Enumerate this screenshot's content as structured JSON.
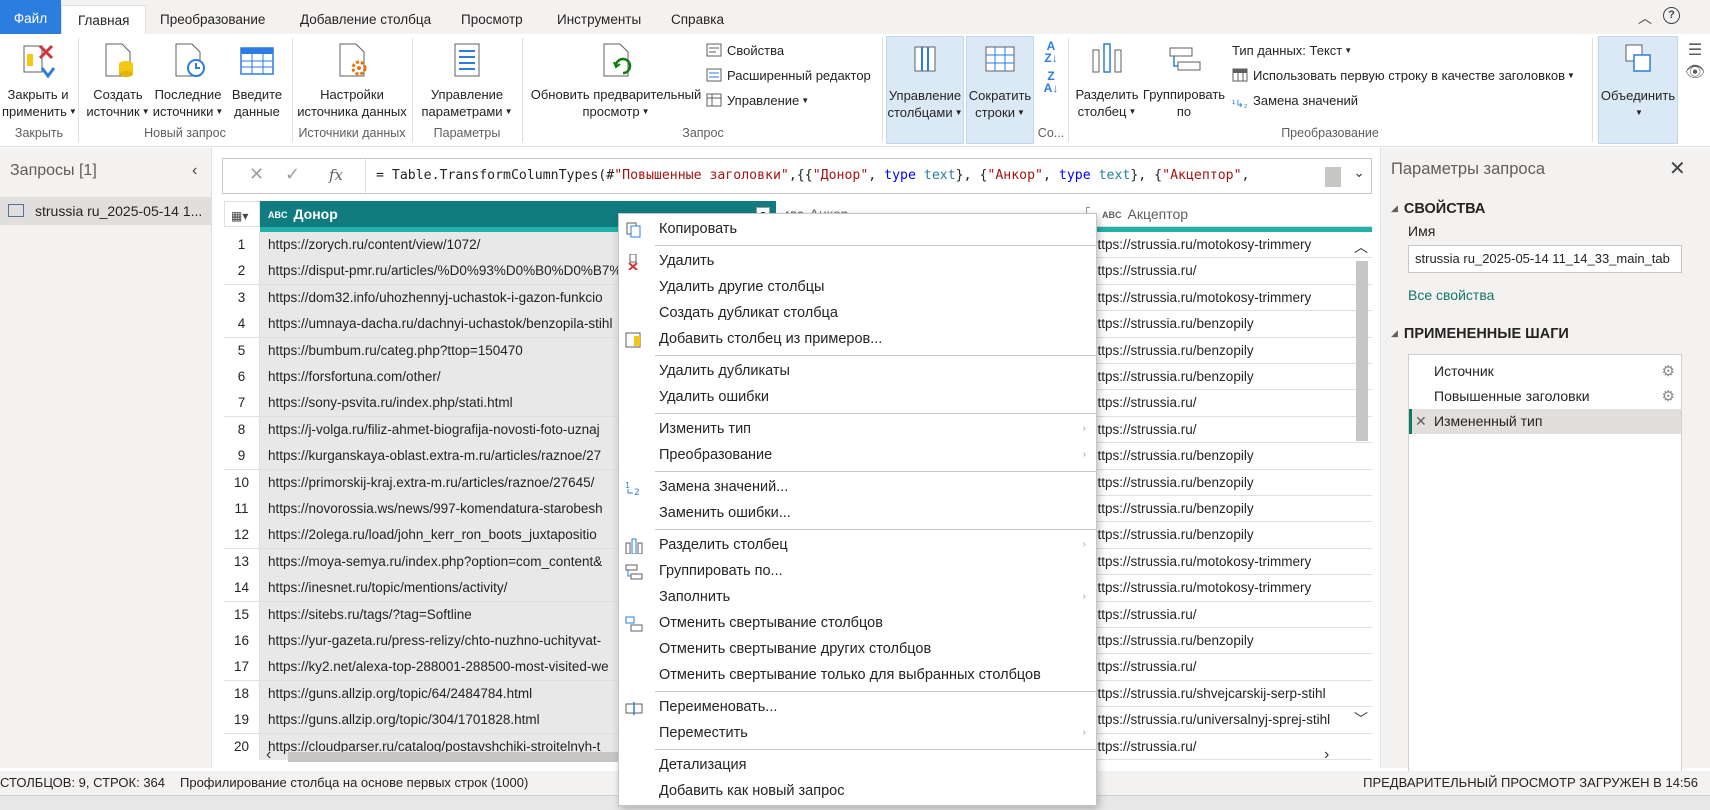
{
  "tabs": [
    "Файл",
    "Главная",
    "Преобразование",
    "Добавление столбца",
    "Просмотр",
    "Инструменты",
    "Справка"
  ],
  "ribbon": {
    "close_apply": [
      "Закрыть и",
      "применить"
    ],
    "new_source": [
      "Создать",
      "источник"
    ],
    "recent_sources": [
      "Последние",
      "источники"
    ],
    "enter_data": [
      "Введите",
      "данные"
    ],
    "ds_settings": [
      "Настройки",
      "источника данных"
    ],
    "manage_params": [
      "Управление",
      "параметрами"
    ],
    "refresh_preview": [
      "Обновить предварительный",
      "просмотр"
    ],
    "properties": "Свойства",
    "advanced_editor": "Расширенный редактор",
    "manage": "Управление",
    "manage_columns": [
      "Управление",
      "столбцами"
    ],
    "reduce_rows": [
      "Сократить",
      "строки"
    ],
    "split_column": [
      "Разделить",
      "столбец"
    ],
    "group_by": [
      "Группировать",
      "по"
    ],
    "data_type": "Тип данных: Текст",
    "first_row_headers": "Использовать первую строку в качестве заголовков",
    "replace_values": "Замена значений",
    "combine": "Объединить",
    "groups": {
      "close": "Закрыть",
      "new_query": "Новый запрос",
      "data_sources": "Источники данных",
      "params": "Параметры",
      "query": "Запрос",
      "sort_short": "Со...",
      "transform": "Преобразование"
    }
  },
  "queries": {
    "title": "Запросы [1]",
    "items": [
      "strussia ru_2025-05-14 1..."
    ]
  },
  "formula": {
    "prefix": "= Table.TransformColumnTypes(#",
    "s1": "\"Повышенные заголовки\"",
    "mid1": ",{{",
    "s2": "\"Донор\"",
    "c1": ", ",
    "kw1": "type",
    "sp": " ",
    "t1": "text",
    "mid2": "}, {",
    "s3": "\"Анкор\"",
    "mid3": "}, {",
    "s4": "\"Акцептор\"",
    "tail": ","
  },
  "columns": {
    "donor": "Донор",
    "ankor": "Анкор",
    "acceptor": "Акцептор",
    "abc": "ABC"
  },
  "rows": [
    {
      "n": "1",
      "donor": "https://zorych.ru/content/view/1072/",
      "acc": "https://strussia.ru/motokosy-trimmery"
    },
    {
      "n": "2",
      "donor": "https://disput-pmr.ru/articles/%D0%93%D0%B0%D0%B7%",
      "acc": "https://strussia.ru/"
    },
    {
      "n": "3",
      "donor": "https://dom32.info/uhozhennyj-uchastok-i-gazon-funkcio",
      "acc": "https://strussia.ru/motokosy-trimmery"
    },
    {
      "n": "4",
      "donor": "https://umnaya-dacha.ru/dachnyi-uchastok/benzopila-stihl",
      "acc": "https://strussia.ru/benzopily"
    },
    {
      "n": "5",
      "donor": "https://bumbum.ru/categ.php?ttop=150470",
      "acc": "https://strussia.ru/benzopily"
    },
    {
      "n": "6",
      "donor": "https://forsfortuna.com/other/",
      "acc": "https://strussia.ru/benzopily"
    },
    {
      "n": "7",
      "donor": "https://sony-psvita.ru/index.php/stati.html",
      "acc": "https://strussia.ru/"
    },
    {
      "n": "8",
      "donor": "https://j-volga.ru/filiz-ahmet-biografija-novosti-foto-uznaj",
      "acc": "https://strussia.ru/"
    },
    {
      "n": "9",
      "donor": "https://kurganskaya-oblast.extra-m.ru/articles/raznoe/27",
      "acc": "https://strussia.ru/benzopily"
    },
    {
      "n": "10",
      "donor": "https://primorskij-kraj.extra-m.ru/articles/raznoe/27645/",
      "acc": "https://strussia.ru/benzopily"
    },
    {
      "n": "11",
      "donor": "https://novorossia.ws/news/997-komendatura-starobesh",
      "acc": "https://strussia.ru/benzopily"
    },
    {
      "n": "12",
      "donor": "https://2olega.ru/load/john_kerr_ron_boots_juxtapositio",
      "acc": "https://strussia.ru/benzopily"
    },
    {
      "n": "13",
      "donor": "https://moya-semya.ru/index.php?option=com_content&",
      "acc": "https://strussia.ru/motokosy-trimmery"
    },
    {
      "n": "14",
      "donor": "https://inesnet.ru/topic/mentions/activity/",
      "acc": "https://strussia.ru/motokosy-trimmery"
    },
    {
      "n": "15",
      "donor": "https://sitebs.ru/tags/?tag=Softline",
      "acc": "https://strussia.ru/"
    },
    {
      "n": "16",
      "donor": "https://yur-gazeta.ru/press-relizy/chto-nuzhno-uchityvat-",
      "acc": "https://strussia.ru/benzopily"
    },
    {
      "n": "17",
      "donor": "https://ky2.net/alexa-top-288001-288500-most-visited-we",
      "acc": "https://strussia.ru/"
    },
    {
      "n": "18",
      "donor": "https://guns.allzip.org/topic/64/2484784.html",
      "acc": "https://strussia.ru/shvejcarskij-serp-stihl"
    },
    {
      "n": "19",
      "donor": "https://guns.allzip.org/topic/304/1701828.html",
      "acc": "https://strussia.ru/universalnyj-sprej-stihl"
    },
    {
      "n": "20",
      "donor": "https://cloudparser.ru/catalog/postavshchiki-stroitelnyh-t",
      "acc": "https://strussia.ru/"
    }
  ],
  "context_menu": [
    {
      "label": "Копировать",
      "icon": "copy-icon"
    },
    {
      "sep": true
    },
    {
      "label": "Удалить",
      "icon": "remove-column-icon"
    },
    {
      "label": "Удалить другие столбцы"
    },
    {
      "label": "Создать дубликат столбца"
    },
    {
      "label": "Добавить столбец из примеров...",
      "icon": "column-from-examples-icon"
    },
    {
      "sep": true
    },
    {
      "label": "Удалить дубликаты"
    },
    {
      "label": "Удалить ошибки"
    },
    {
      "sep": true
    },
    {
      "label": "Изменить тип",
      "sub": true
    },
    {
      "label": "Преобразование",
      "sub": true
    },
    {
      "sep": true
    },
    {
      "label": "Замена значений...",
      "icon": "replace-values-icon"
    },
    {
      "label": "Заменить ошибки..."
    },
    {
      "sep": true
    },
    {
      "label": "Разделить столбец",
      "sub": true,
      "icon": "split-column-icon"
    },
    {
      "label": "Группировать по...",
      "icon": "group-by-icon"
    },
    {
      "label": "Заполнить",
      "sub": true
    },
    {
      "label": "Отменить свертывание столбцов",
      "icon": "unpivot-icon"
    },
    {
      "label": "Отменить свертывание других столбцов"
    },
    {
      "label": "Отменить свертывание только для выбранных столбцов"
    },
    {
      "sep": true
    },
    {
      "label": "Переименовать...",
      "icon": "rename-icon"
    },
    {
      "label": "Переместить",
      "sub": true
    },
    {
      "sep": true
    },
    {
      "label": "Детализация"
    },
    {
      "label": "Добавить как новый запрос"
    }
  ],
  "query_settings": {
    "title": "Параметры запроса",
    "properties": "СВОЙСТВА",
    "name_label": "Имя",
    "name_value": "strussia ru_2025-05-14 11_14_33_main_tab",
    "all_props": "Все свойства",
    "applied_steps": "ПРИМЕНЕННЫЕ ШАГИ",
    "steps": [
      "Источник",
      "Повышенные заголовки",
      "Измененный тип"
    ]
  },
  "status": {
    "counts": "СТОЛБЦОВ: 9, СТРОК: 364",
    "profiling": "Профилирование столбца на основе первых строк (1000)",
    "preview": "ПРЕДВАРИТЕЛЬНЫЙ ПРОСМОТР ЗАГРУЖЕН В 14:56"
  },
  "colors": {
    "accent": "#2b7de0",
    "teal": "#107c80",
    "teal_bar": "#20b2aa",
    "link": "#117865"
  }
}
